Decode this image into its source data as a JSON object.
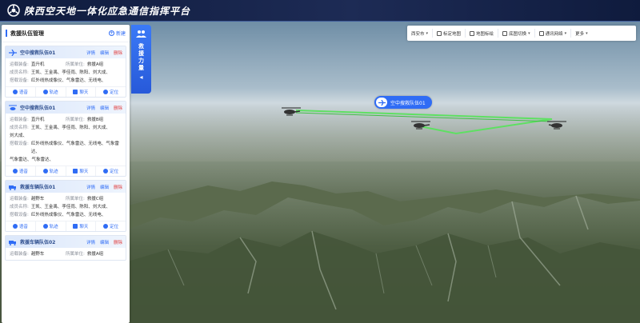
{
  "header": {
    "title": "陕西空天地一体化应急通信指挥平台"
  },
  "side_tab": {
    "label": "救援力量"
  },
  "panel": {
    "title": "救援队伍管理",
    "new_label": "新建",
    "cards": [
      {
        "name": "空中搜救队伍01",
        "actions": [
          "详情",
          "编辑",
          "删除"
        ],
        "carrier_label": "运载装备:",
        "carrier": "直升机",
        "unit_label": "所属单位:",
        "unit": "救援A组",
        "members_label": "成员名称:",
        "members": [
          "王凯、王金禹、李佳雨、陈阳、刘大成、"
        ],
        "equipment_label": "搭载设备:",
        "equipment": [
          "红外线热成像仪、气象雷达、无线电、"
        ],
        "footer": [
          "语音",
          "轨迹",
          "聊天",
          "定位"
        ]
      },
      {
        "name": "空中搜救队伍01",
        "actions": [
          "详情",
          "编辑",
          "删除"
        ],
        "carrier_label": "运载装备:",
        "carrier": "直升机",
        "unit_label": "所属单位:",
        "unit": "救援B组",
        "members_label": "成员名称:",
        "members": [
          "王凯、王金禹、李佳雨、陈阳、刘大成、",
          "刘大成、"
        ],
        "equipment_label": "搭载设备:",
        "equipment": [
          "红外线热成像仪、气象雷达、无线电、气象雷达、",
          "气象雷达、气象雷达、"
        ],
        "footer": [
          "语音",
          "轨迹",
          "聊天",
          "定位"
        ]
      },
      {
        "name": "救援车辆队伍01",
        "actions": [
          "详情",
          "编辑",
          "删除"
        ],
        "carrier_label": "运载装备:",
        "carrier": "越野车",
        "unit_label": "所属单位:",
        "unit": "救援C组",
        "members_label": "成员名称:",
        "members": [
          "王凯、王金禹、李佳雨、陈阳、刘大成、"
        ],
        "equipment_label": "搭载设备:",
        "equipment": [
          "红外线热成像仪、气象雷达、无线电、"
        ],
        "footer": [
          "语音",
          "轨迹",
          "聊天",
          "定位"
        ]
      },
      {
        "name": "救援车辆队伍02",
        "actions": [
          "详情",
          "编辑",
          "删除"
        ],
        "carrier_label": "运载装备:",
        "carrier": "越野车",
        "unit_label": "所属单位:",
        "unit": "救援A组"
      }
    ]
  },
  "toolbar": {
    "items": [
      {
        "label": "西安市",
        "icon": "none",
        "dropdown": true
      },
      {
        "label": "标定地图",
        "icon": "pin-icon",
        "dropdown": false
      },
      {
        "label": "地图标绘",
        "icon": "draw-icon",
        "dropdown": false
      },
      {
        "label": "底图切换",
        "icon": "layers-icon",
        "dropdown": true
      },
      {
        "label": "通讯网络",
        "icon": "network-icon",
        "dropdown": true
      },
      {
        "label": "更多",
        "icon": "none",
        "dropdown": true
      }
    ]
  },
  "map": {
    "callout_label": "空中搜救队伍01"
  },
  "colors": {
    "accent": "#2f6cf5",
    "header_bg": "#16224a",
    "danger": "#e03b3b",
    "track": "#4fe35a"
  }
}
